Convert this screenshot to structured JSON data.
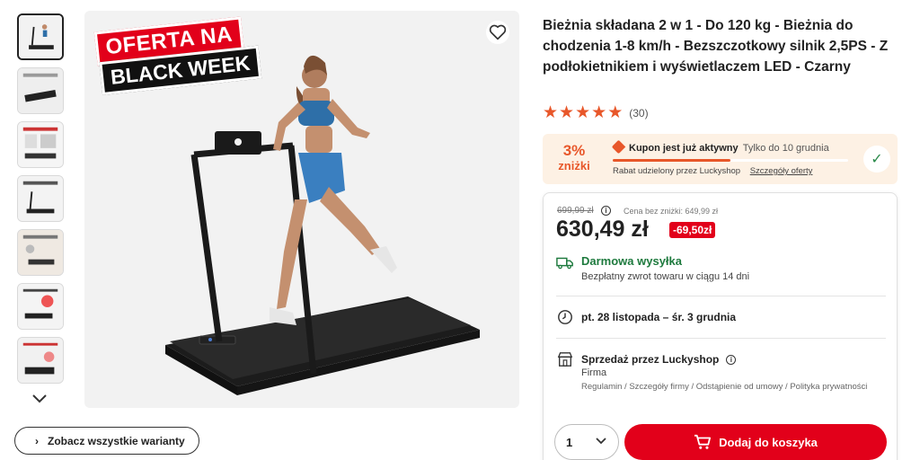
{
  "product": {
    "title": "Bieżnia składana 2 w 1 - Do 120 kg - Bieżnia do chodzenia 1-8 km/h - Bezszczotkowy silnik 2,5PS - Z podłokietnikiem i wyświetlaczem LED - Czarny",
    "rating": 5,
    "rating_count": "(30)",
    "badge_line1": "OFERTA NA",
    "badge_line2": "BLACK WEEK"
  },
  "gallery": {
    "thumbnail_count": 7,
    "variants_button": "Zobacz wszystkie warianty"
  },
  "coupon": {
    "percent": "3%",
    "percent_suffix": "zniżki",
    "active_label": "Kupon jest już aktywny",
    "valid_until": "Tylko do 10 grudnia",
    "progress": 0.5,
    "granted_by": "Rabat udzielony przez Luckyshop",
    "details_link": "Szczegóły oferty"
  },
  "pricing": {
    "old_price": "699,99 zł",
    "no_discount_price": "Cena bez zniżki: 649,99 zł",
    "price": "630,49 zł",
    "discount": "-69,50zł"
  },
  "shipping": {
    "title": "Darmowa wysyłka",
    "returns": "Bezpłatny zwrot towaru w ciągu 14 dni"
  },
  "delivery": {
    "dates": "pt. 28 listopada – śr. 3 grudnia"
  },
  "seller": {
    "title": "Sprzedaż przez Luckyshop",
    "type": "Firma",
    "links": "Regulamin / Szczegóły firmy / Odstąpienie od umowy / Polityka prywatności"
  },
  "cart": {
    "quantity": "1",
    "add_label": "Dodaj do koszyka"
  },
  "colors": {
    "accent_red": "#e2001a",
    "accent_orange": "#e8572a",
    "success_green": "#1e7a3e",
    "coupon_bg": "#fdf1e4"
  }
}
